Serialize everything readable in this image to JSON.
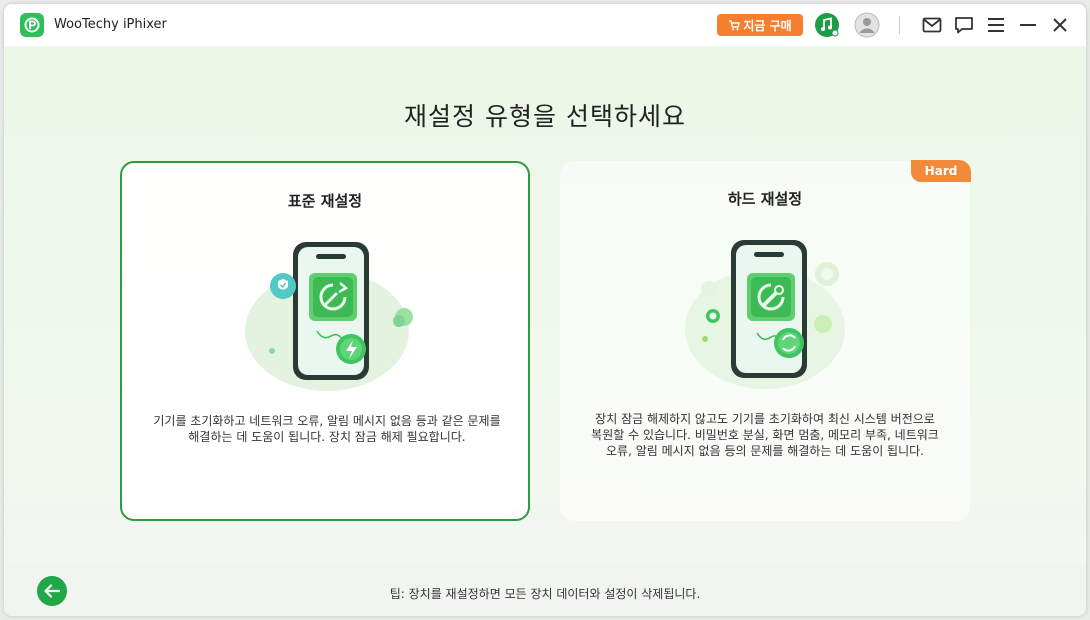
{
  "titlebar": {
    "app_name": "WooTechy iPhixer",
    "buy_label": "지금 구매",
    "icons": [
      "music-icon",
      "user-icon",
      "mail-icon",
      "chat-icon",
      "menu-icon",
      "minimize-icon",
      "close-icon"
    ]
  },
  "main": {
    "heading": "재설정 유형을 선택하세요",
    "cards": [
      {
        "title": "표준 재설정",
        "description": "기기를 초기화하고 네트워크 오류, 알림 메시지 없음 등과 같은 문제를 해결하는 데 도움이 됩니다. 장치 잠금 해제 필요합니다.",
        "selected": true
      },
      {
        "title": "하드 재설정",
        "badge": "Hard",
        "description": "장치 잠금 해제하지 않고도 기기를 초기화하여 최신 시스템 버전으로 복원할 수 있습니다. 비밀번호 분실, 화면 멈춤, 메모리 부족, 네트워크 오류, 알림 메시지 없음 등의 문제를 해결하는 데 도움이 됩니다.",
        "selected": false
      }
    ]
  },
  "footer": {
    "tip": "팁: 장치를 재설정하면 모든 장치 데이터와 설정이 삭제됩니다."
  },
  "colors": {
    "accent_green": "#2e9b3e",
    "buy_orange": "#f57f2f",
    "badge_orange": "#f28a3c"
  }
}
